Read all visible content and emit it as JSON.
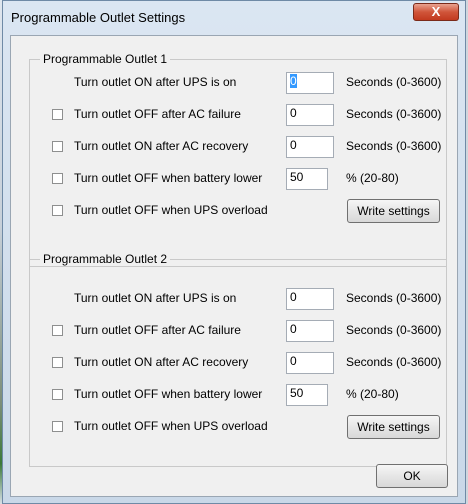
{
  "window": {
    "title": "Programmable Outlet Settings",
    "close_glyph": "X"
  },
  "outlet1": {
    "label": "Programmable Outlet 1",
    "rows": [
      {
        "label": "Turn outlet ON after UPS is on",
        "has_checkbox": false,
        "checked": false,
        "value": "0",
        "unit": "Seconds (0-3600)"
      },
      {
        "label": "Turn outlet OFF after AC failure",
        "has_checkbox": true,
        "checked": false,
        "value": "0",
        "unit": "Seconds (0-3600)"
      },
      {
        "label": "Turn outlet ON after AC recovery",
        "has_checkbox": true,
        "checked": false,
        "value": "0",
        "unit": "Seconds (0-3600)"
      },
      {
        "label": "Turn outlet OFF when battery lower",
        "has_checkbox": true,
        "checked": false,
        "value": "50",
        "unit": "% (20-80)"
      },
      {
        "label": "Turn outlet OFF when UPS overload",
        "has_checkbox": true,
        "checked": false
      }
    ],
    "write_button": "Write settings"
  },
  "outlet2": {
    "label": "Programmable Outlet 2",
    "rows": [
      {
        "label": "Turn outlet ON after UPS is on",
        "has_checkbox": false,
        "checked": false,
        "value": "0",
        "unit": "Seconds (0-3600)"
      },
      {
        "label": "Turn outlet OFF after AC failure",
        "has_checkbox": true,
        "checked": false,
        "value": "0",
        "unit": "Seconds (0-3600)"
      },
      {
        "label": "Turn outlet ON after AC recovery",
        "has_checkbox": true,
        "checked": false,
        "value": "0",
        "unit": "Seconds (0-3600)"
      },
      {
        "label": "Turn outlet OFF when battery lower",
        "has_checkbox": true,
        "checked": false,
        "value": "50",
        "unit": "% (20-80)"
      },
      {
        "label": "Turn outlet OFF when UPS overload",
        "has_checkbox": true,
        "checked": false
      }
    ],
    "write_button": "Write settings"
  },
  "ok_button": "OK",
  "colors": {
    "selection": "#3399ff",
    "close_button": "#c23a1f"
  }
}
